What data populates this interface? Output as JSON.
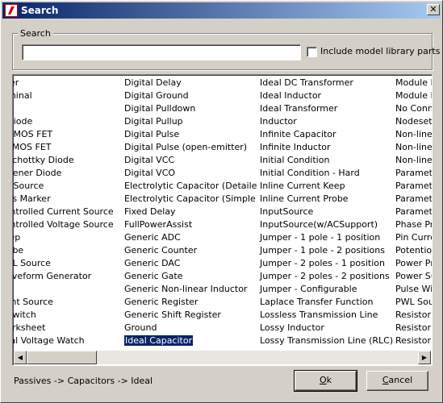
{
  "window": {
    "title": "Search",
    "close_glyph": "✕",
    "icon": "app-logo-icon"
  },
  "search": {
    "group_label": "Search",
    "query": "",
    "placeholder": "",
    "include_model_library_label": "Include model library parts",
    "include_model_library_checked": false
  },
  "list": {
    "columns": [
      [
        "pper",
        "erminal",
        "itor",
        "e Diode",
        "e NMOS FET",
        "e PMOS FET",
        "e Schottky Diode",
        "e Zener Diode",
        " AC Source",
        " Bias Marker",
        " Controlled Current Source",
        " Controlled Voltage Source",
        " Keep",
        " Probe",
        " PWL Source",
        " Waveform Generator",
        "be",
        "rrent Source",
        "d Switch",
        " Worksheet",
        "ntial Voltage Watch"
      ],
      [
        "Digital Delay",
        "Digital Ground",
        "Digital Pulldown",
        "Digital Pullup",
        "Digital Pulse",
        "Digital Pulse (open-emitter)",
        "Digital VCC",
        "Digital VCO",
        "Electrolytic Capacitor (Detailed)",
        "Electrolytic Capacitor (Simple)",
        "Fixed Delay",
        "FullPowerAssist",
        "Generic ADC",
        "Generic Counter",
        "Generic DAC",
        "Generic Gate",
        "Generic Non-linear Inductor",
        "Generic Register",
        "Generic Shift Register",
        "Ground",
        "Ideal Capacitor"
      ],
      [
        "Ideal DC Transformer",
        "Ideal Inductor",
        "Ideal Transformer",
        "Inductor",
        "Infinite Capacitor",
        "Infinite Inductor",
        "Initial Condition",
        "Initial Condition - Hard",
        "Inline Current Keep",
        "Inline Current Probe",
        "InputSource",
        "InputSource(w/ACSupport)",
        "Jumper - 1 pole - 1 position",
        "Jumper - 1 pole - 2 positions",
        "Jumper - 2 poles - 1 position",
        "Jumper - 2 poles - 2 positions",
        "Jumper - Configurable",
        "Laplace Transfer Function",
        "Lossless Transmission Line",
        "Lossy Inductor",
        "Lossy Transmission Line (RLC)"
      ],
      [
        "Module B",
        "Module F",
        "No Conne",
        "Nodeset",
        "Non-linea",
        "Non-linea",
        "Non-linea",
        "Paramete",
        "Paramete",
        "Paramete",
        "Paramete",
        "Phase Pr",
        "Pin Curre",
        "Potention",
        "Power Pr",
        "Power Su",
        "Pulse Wi",
        "PWL Sou",
        "Resistor (",
        "Resistor (",
        "Resistor E"
      ]
    ],
    "selected": {
      "column": 1,
      "row": 20
    }
  },
  "scrollbar": {
    "left_arrow": "◀",
    "right_arrow": "▶"
  },
  "footer": {
    "path": "Passives -> Capacitors -> Ideal",
    "ok_hotkey": "O",
    "ok_rest": "k",
    "cancel_hotkey": "C",
    "cancel_rest": "ancel"
  }
}
